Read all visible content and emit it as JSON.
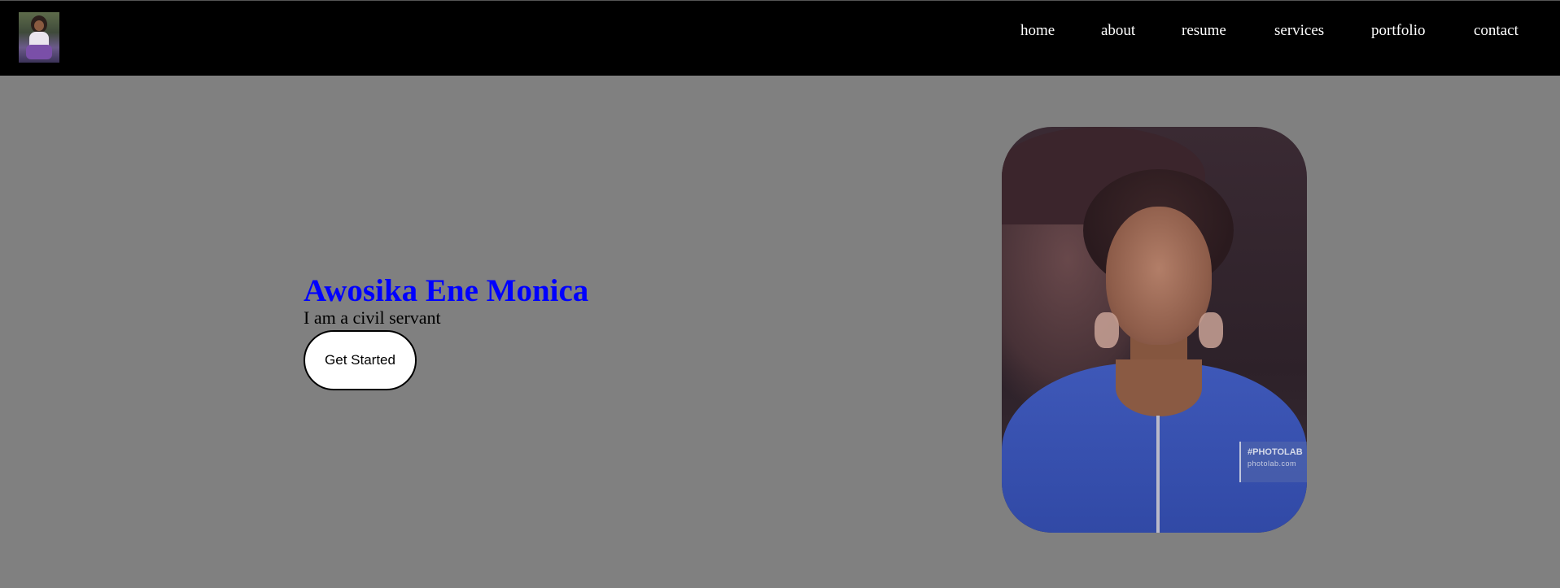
{
  "nav": {
    "items": [
      "home",
      "about",
      "resume",
      "services",
      "portfolio",
      "contact"
    ]
  },
  "hero": {
    "name": "Awosika Ene Monica",
    "tagline": "I am a civil servant",
    "cta_label": "Get Started"
  },
  "portrait": {
    "watermark_brand": "#PHOTOLAB",
    "watermark_url": "photolab.com"
  },
  "colors": {
    "nav_background": "#000000",
    "page_background": "#808080",
    "name_color": "#0000ff",
    "button_background": "#ffffff",
    "shirt_color": "#3e58b8"
  }
}
